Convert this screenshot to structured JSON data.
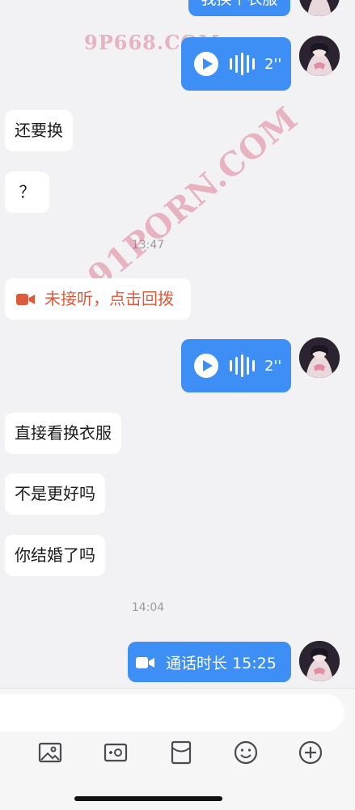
{
  "messages": {
    "top_out_partial": "我换个衣服",
    "voice_duration_1": "2''",
    "in_1": "还要换",
    "in_2": "？",
    "time_1": "13:47",
    "missed_call": "未接听，点击回拨",
    "voice_duration_2": "2''",
    "in_3": "直接看换衣服",
    "in_4": "不是更好吗",
    "in_5": "你结婚了吗",
    "time_2": "14:04",
    "call_duration": "通话时长 15:25"
  },
  "watermarks": {
    "top": "9P668.COM",
    "diagonal": "91PORN.COM"
  },
  "toolbar": {
    "icons": [
      "image-icon",
      "camera-icon",
      "red-packet-icon",
      "emoji-icon",
      "plus-icon"
    ]
  },
  "colors": {
    "outgoing_bubble": "#3d8ff5",
    "incoming_bubble": "#ffffff",
    "missed_call_text": "#dd5a3c",
    "background": "#f2f2f4"
  }
}
